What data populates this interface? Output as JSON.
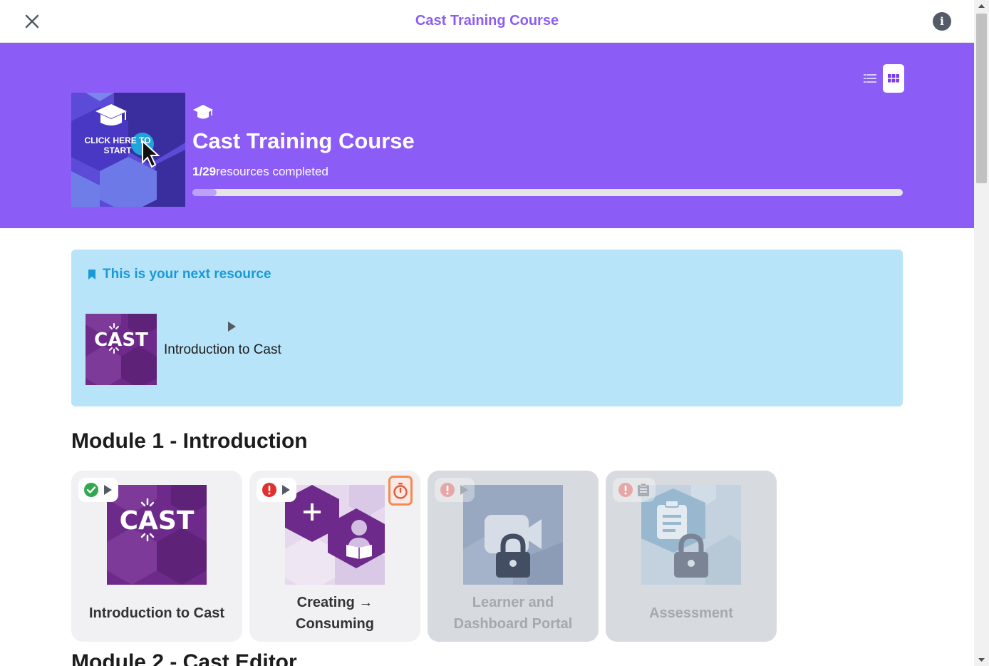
{
  "topbar": {
    "title": "Cast Training Course",
    "close_icon": "close-icon",
    "info_icon": "info-icon",
    "info_glyph": "i"
  },
  "hero": {
    "background": "#8b5cf6",
    "thumbnail_text": "CLICK HERE TO START",
    "title": "Cast Training Course",
    "completed": "1/29",
    "completed_suffix": "resources completed",
    "progress_fraction": 0.034,
    "view_options": [
      "list-view-icon",
      "grid-view-icon"
    ],
    "active_view": "grid"
  },
  "next_resource": {
    "heading": "This is your next resource",
    "item_title": "Introduction to Cast",
    "thumb_label": "CAST"
  },
  "modules": [
    {
      "title": "Module 1 - Introduction",
      "cards": [
        {
          "title": "Introduction to Cast",
          "status": "completed",
          "type": "video",
          "locked": false,
          "thumb_label": "CAST"
        },
        {
          "title": "Creating → Consuming",
          "status": "required",
          "type": "video",
          "locked": false,
          "timed": true
        },
        {
          "title": "Learner and Dashboard Portal",
          "status": "required",
          "type": "video",
          "locked": true
        },
        {
          "title": "Assessment",
          "status": "required",
          "type": "assessment",
          "locked": true
        }
      ]
    },
    {
      "title": "Module 2 - Cast Editor"
    }
  ],
  "colors": {
    "accent": "#8b5cf6",
    "next_bg": "#b8e4f9",
    "next_heading": "#199ad6",
    "completed_green": "#2fa84f",
    "required_red": "#e0302f",
    "timer_orange": "#f28b54"
  }
}
